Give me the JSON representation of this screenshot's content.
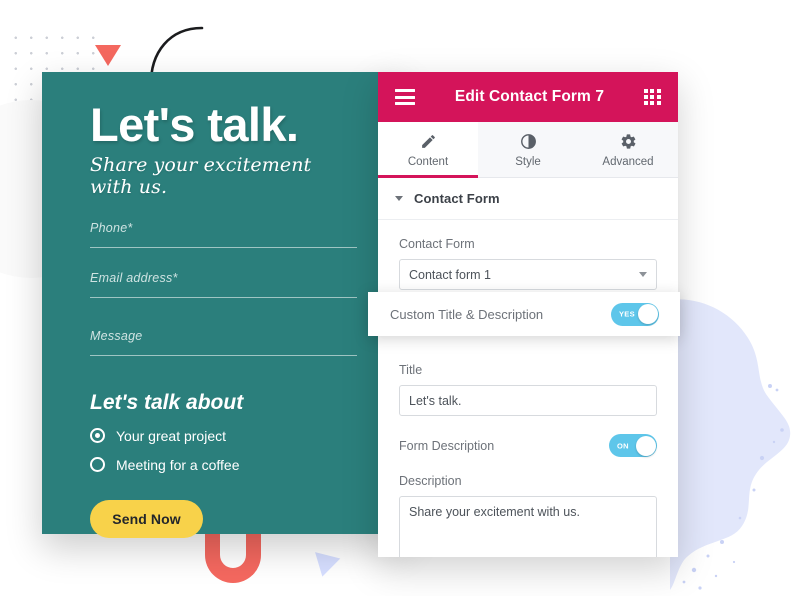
{
  "decor": {
    "teal": "#2b7f7c",
    "pink": "#d4145a",
    "yellow": "#f8d24a",
    "coral": "#f4685f",
    "lavender": "#d6deff",
    "toggle_blue": "#5ec6ea"
  },
  "contact_card": {
    "title": "Let's talk.",
    "subtitle": "Share your excitement with us.",
    "fields": [
      {
        "label": "Phone*"
      },
      {
        "label": "Email address*"
      },
      {
        "label": "Message"
      }
    ],
    "about_title": "Let's talk about",
    "options": [
      {
        "label": "Your great project",
        "checked": true
      },
      {
        "label": "Meeting for a coffee",
        "checked": false
      }
    ],
    "submit_label": "Send Now"
  },
  "editor": {
    "header": {
      "title": "Edit Contact Form 7",
      "menu_icon": "hamburger-icon",
      "grid_icon": "grid-icon"
    },
    "tabs": [
      {
        "label": "Content",
        "icon": "pencil-icon",
        "active": true
      },
      {
        "label": "Style",
        "icon": "contrast-icon",
        "active": false
      },
      {
        "label": "Advanced",
        "icon": "gear-icon",
        "active": false
      }
    ],
    "section": {
      "title": "Contact Form",
      "collapse_icon": "caret-down-icon"
    },
    "controls": {
      "contact_form_label": "Contact Form",
      "contact_form_value": "Contact form 1",
      "custom_title_label": "Custom Title & Description",
      "custom_title_state": "YES",
      "title_label": "Title",
      "title_value": "Let's talk.",
      "form_description_label": "Form Description",
      "form_description_state": "ON",
      "description_label": "Description",
      "description_value": "Share your excitement with us."
    }
  }
}
